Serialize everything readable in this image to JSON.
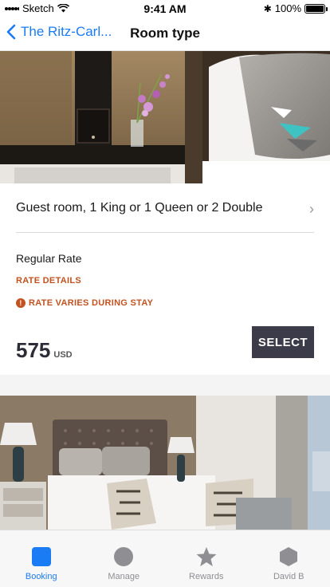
{
  "status": {
    "carrier": "Sketch",
    "time": "9:41 AM",
    "battery": "100%"
  },
  "nav": {
    "back_label": "The Ritz-Carl...",
    "title": "Room type"
  },
  "room": {
    "name": "Guest room, 1 King or 1 Queen or 2 Double",
    "rate_name": "Regular Rate",
    "rate_details_label": "RATE DETAILS",
    "rate_warning": "RATE VARIES DURING STAY",
    "price": "575",
    "currency": "USD",
    "select_label": "SELECT"
  },
  "colors": {
    "accent": "#1a7cf5",
    "warning": "#c2521f",
    "button": "#3b3b4a"
  },
  "tabs": [
    {
      "label": "Booking",
      "icon": "square-icon",
      "active": true
    },
    {
      "label": "Manage",
      "icon": "circle-icon",
      "active": false
    },
    {
      "label": "Rewards",
      "icon": "star-icon",
      "active": false
    },
    {
      "label": "David B",
      "icon": "hexagon-icon",
      "active": false
    }
  ]
}
